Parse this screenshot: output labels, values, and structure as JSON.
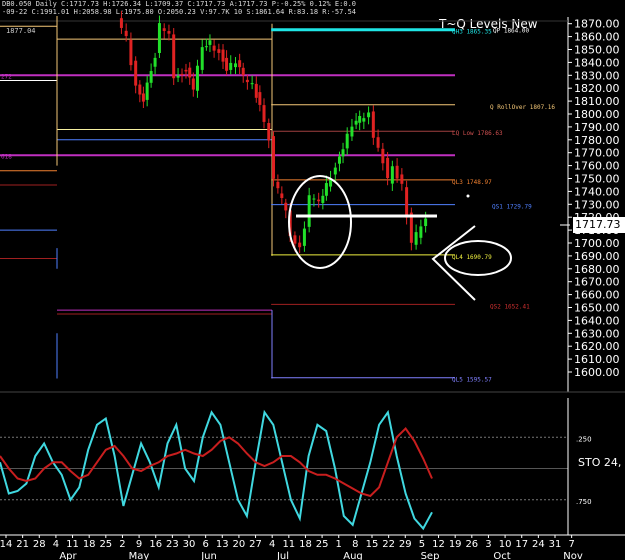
{
  "header": {
    "line1": "DB0.050 Daily  C:1717.73  H:1726.34  L:1709.37  C:1717.73  A:1717.73  P:-0.25%  0.12%  E:0.0",
    "line2": "-09-22  C:1991.01  H:2058.98  L:1975.80  O:2050.23  V:97.7K  10  S:1861.64  R:83.18  R:-57.54",
    "corner": "1877.04",
    "title": "T~Q Levels New"
  },
  "price_badge": "1717.73",
  "sto_label": "STO 24,",
  "colors": {
    "background": "#000000",
    "candle_up": "#22e02a",
    "candle_down": "#e02222",
    "axis": "#ffffff",
    "stoch_fast": "#40d8e0",
    "stoch_slow": "#c81e1e"
  },
  "levels": [
    {
      "label": "QH3 1865.35",
      "price": 1865.35,
      "color": "#1fe6e6",
      "start": "Jul 1",
      "label_color": "#1fe6e6"
    },
    {
      "label": "QP 1864.00",
      "price": 1864.0,
      "color": "#ffffff",
      "start": "Jul 1",
      "label_color": "#ffffff"
    },
    {
      "label": "Q RollOver 1807.16",
      "price": 1807.16,
      "color": "#f5c878",
      "start": "Jul 1",
      "label_color": "#f5c878"
    },
    {
      "label": "LQ Low 1786.63",
      "price": 1786.63,
      "color": "#a04040",
      "start": "Jul 1",
      "label_color": "#d05050"
    },
    {
      "label": "QL3 1748.97",
      "price": 1748.97,
      "color": "#f08030",
      "start": "Jul 1",
      "label_color": "#f08030"
    },
    {
      "label": "QS1 1729.79",
      "price": 1729.79,
      "color": "#5080ff",
      "start": "Jul 1",
      "label_color": "#5080ff"
    },
    {
      "label": "QL4 1690.79",
      "price": 1690.79,
      "color": "#f0f040",
      "start": "Jul 1",
      "label_color": "#f0f040"
    },
    {
      "label": "QS2 1652.41",
      "price": 1652.41,
      "color": "#a02020",
      "start": "Jul 1",
      "label_color": "#d03030"
    },
    {
      "label": "QL5 1595.57",
      "price": 1595.57,
      "color": "#8080ff",
      "start": "Jul 1",
      "label_color": "#8080ff"
    }
  ],
  "left_labels": [
    {
      "text": "272",
      "price": 1830
    },
    {
      "text": "618",
      "price": 1768
    }
  ],
  "chart_data": [
    {
      "type": "candlestick",
      "title": "T~Q Levels New",
      "ylim": [
        1590,
        1878
      ],
      "yticks": [
        1600,
        1610,
        1620,
        1630,
        1640,
        1650,
        1660,
        1670,
        1680,
        1690,
        1700,
        1710,
        1720,
        1730,
        1740,
        1750,
        1760,
        1770,
        1780,
        1790,
        1800,
        1810,
        1820,
        1830,
        1840,
        1850,
        1860,
        1870
      ],
      "last_price": 1717.73,
      "close_path": [
        {
          "date": "Apr 28",
          "close": 1874
        },
        {
          "date": "May 2",
          "close": 1858
        },
        {
          "date": "May 6",
          "close": 1822
        },
        {
          "date": "May 9",
          "close": 1812
        },
        {
          "date": "May 14",
          "close": 1846
        },
        {
          "date": "May 16",
          "close": 1868
        },
        {
          "date": "May 20",
          "close": 1860
        },
        {
          "date": "May 22",
          "close": 1830
        },
        {
          "date": "May 27",
          "close": 1834
        },
        {
          "date": "May 30",
          "close": 1820
        },
        {
          "date": "Jun 3",
          "close": 1850
        },
        {
          "date": "Jun 6",
          "close": 1855
        },
        {
          "date": "Jun 10",
          "close": 1848
        },
        {
          "date": "Jun 13",
          "close": 1836
        },
        {
          "date": "Jun 17",
          "close": 1840
        },
        {
          "date": "Jun 20",
          "close": 1828
        },
        {
          "date": "Jun 24",
          "close": 1822
        },
        {
          "date": "Jun 27",
          "close": 1808
        },
        {
          "date": "Jul 1",
          "close": 1782
        },
        {
          "date": "Jul 3",
          "close": 1748
        },
        {
          "date": "Jul 8",
          "close": 1725
        },
        {
          "date": "Jul 10",
          "close": 1706
        },
        {
          "date": "Jul 14",
          "close": 1698
        },
        {
          "date": "Jul 16",
          "close": 1712
        },
        {
          "date": "Jul 18",
          "close": 1735
        },
        {
          "date": "Jul 22",
          "close": 1730
        },
        {
          "date": "Jul 25",
          "close": 1745
        },
        {
          "date": "Jul 29",
          "close": 1760
        },
        {
          "date": "Aug 1",
          "close": 1775
        },
        {
          "date": "Aug 5",
          "close": 1790
        },
        {
          "date": "Aug 8",
          "close": 1796
        },
        {
          "date": "Aug 12",
          "close": 1800
        },
        {
          "date": "Aug 14",
          "close": 1784
        },
        {
          "date": "Aug 18",
          "close": 1764
        },
        {
          "date": "Aug 20",
          "close": 1748
        },
        {
          "date": "Aug 22",
          "close": 1758
        },
        {
          "date": "Aug 26",
          "close": 1745
        },
        {
          "date": "Aug 28",
          "close": 1722
        },
        {
          "date": "Aug 30",
          "close": 1700
        },
        {
          "date": "Sep 3",
          "close": 1712
        },
        {
          "date": "Sep 5",
          "close": 1717.73
        }
      ]
    },
    {
      "type": "line",
      "title": "STO 24,",
      "ylim": [
        0,
        1
      ],
      "yticks": [
        ".250",
        ".750"
      ],
      "series": [
        {
          "name": "fast",
          "values": [
            0.55,
            0.3,
            0.32,
            0.38,
            0.6,
            0.7,
            0.55,
            0.45,
            0.25,
            0.35,
            0.65,
            0.85,
            0.9,
            0.6,
            0.2,
            0.45,
            0.7,
            0.55,
            0.35,
            0.7,
            0.85,
            0.5,
            0.4,
            0.75,
            0.95,
            0.85,
            0.55,
            0.25,
            0.12,
            0.55,
            0.95,
            0.85,
            0.55,
            0.25,
            0.1,
            0.6,
            0.85,
            0.8,
            0.5,
            0.12,
            0.05,
            0.3,
            0.55,
            0.85,
            0.95,
            0.6,
            0.3,
            0.1,
            0.02,
            0.15
          ]
        },
        {
          "name": "slow",
          "values": [
            0.6,
            0.5,
            0.42,
            0.4,
            0.42,
            0.5,
            0.55,
            0.55,
            0.48,
            0.42,
            0.45,
            0.55,
            0.65,
            0.68,
            0.6,
            0.5,
            0.48,
            0.52,
            0.55,
            0.6,
            0.62,
            0.65,
            0.62,
            0.6,
            0.65,
            0.72,
            0.75,
            0.7,
            0.62,
            0.55,
            0.52,
            0.55,
            0.6,
            0.6,
            0.55,
            0.48,
            0.45,
            0.45,
            0.42,
            0.38,
            0.34,
            0.3,
            0.28,
            0.35,
            0.55,
            0.75,
            0.82,
            0.72,
            0.58,
            0.42
          ]
        }
      ]
    }
  ],
  "x_axis": {
    "day_ticks": [
      "14",
      "21",
      "28",
      "4",
      "11",
      "18",
      "25",
      "2",
      "9",
      "16",
      "23",
      "30",
      "6",
      "13",
      "20",
      "27",
      "4",
      "11",
      "18",
      "25",
      "1",
      "8",
      "15",
      "22",
      "29",
      "5",
      "12",
      "19",
      "26",
      "3",
      "10",
      "17",
      "24",
      "31",
      "7"
    ],
    "months": [
      {
        "label": "Apr"
      },
      {
        "label": "May"
      },
      {
        "label": "Jun"
      },
      {
        "label": "Jul"
      },
      {
        "label": "Aug"
      },
      {
        "label": "Sep"
      },
      {
        "label": "Oct"
      },
      {
        "label": "Nov"
      }
    ]
  }
}
